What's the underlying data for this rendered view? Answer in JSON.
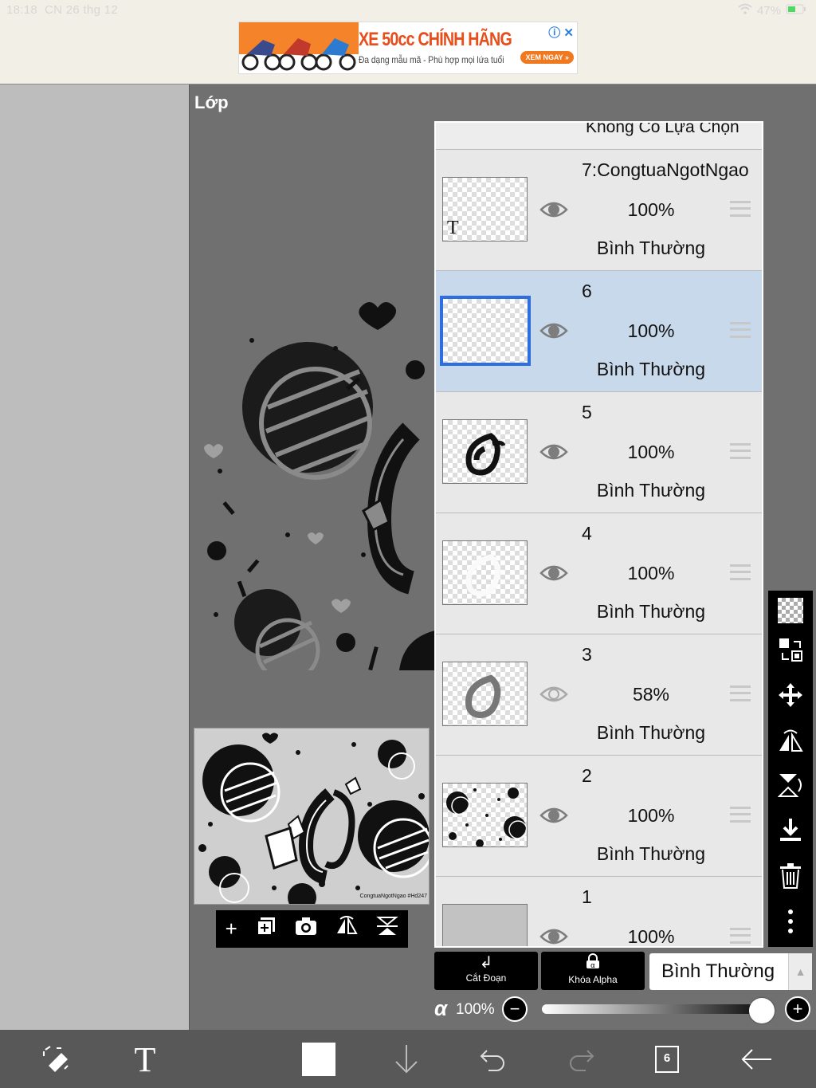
{
  "status": {
    "time": "18:18",
    "date": "CN 26 thg 12",
    "battery": "47%"
  },
  "ad": {
    "title": "XE 50cc CHÍNH HÃNG",
    "subtitle": "Đa dạng mẫu mã - Phù hợp mọi lứa tuổi",
    "cta": "XEM NGAY »"
  },
  "panel": {
    "title": "Lớp"
  },
  "preview": {
    "watermark": "CongtuaNgotNgao #Hd247"
  },
  "layers": {
    "no_selection": "Không Có Lựa Chọn",
    "items": [
      {
        "name": "7:CongtuaNgotNgao",
        "opacity": "100%",
        "mode": "Bình Thường",
        "visible": true,
        "selected": false
      },
      {
        "name": "6",
        "opacity": "100%",
        "mode": "Bình Thường",
        "visible": true,
        "selected": true
      },
      {
        "name": "5",
        "opacity": "100%",
        "mode": "Bình Thường",
        "visible": true,
        "selected": false
      },
      {
        "name": "4",
        "opacity": "100%",
        "mode": "Bình Thường",
        "visible": true,
        "selected": false
      },
      {
        "name": "3",
        "opacity": "58%",
        "mode": "Bình Thường",
        "visible": false,
        "selected": false
      },
      {
        "name": "2",
        "opacity": "100%",
        "mode": "Bình Thường",
        "visible": true,
        "selected": false
      },
      {
        "name": "1",
        "opacity": "100%",
        "mode": "",
        "visible": true,
        "selected": false
      }
    ]
  },
  "buttons": {
    "clip_label": "Cắt Đoạn",
    "alpha_lock_label": "Khóa Alpha",
    "blend_mode": "Bình Thường"
  },
  "alpha": {
    "symbol": "α",
    "value": "100%",
    "level": 1.0
  },
  "bottom": {
    "layer_count": "6"
  },
  "colors": {
    "selected_layer": "#c9d9ec",
    "selection_border": "#2d6fe0",
    "panel_bg": "#707070"
  }
}
